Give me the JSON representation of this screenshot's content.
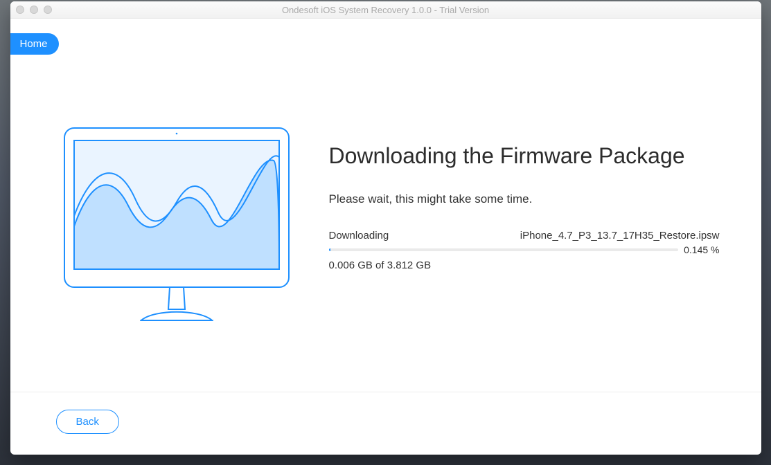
{
  "window": {
    "title": "Ondesoft iOS System Recovery 1.0.0 - Trial Version"
  },
  "home": {
    "label": "Home"
  },
  "heading": "Downloading the Firmware Package",
  "subheading": "Please wait, this might take some time.",
  "download": {
    "label": "Downloading",
    "filename": "iPhone_4.7_P3_13.7_17H35_Restore.ipsw",
    "percent_text": "0.145 %",
    "percent_value": 0.145,
    "amount": "0.006 GB of 3.812 GB"
  },
  "back": {
    "label": "Back"
  }
}
